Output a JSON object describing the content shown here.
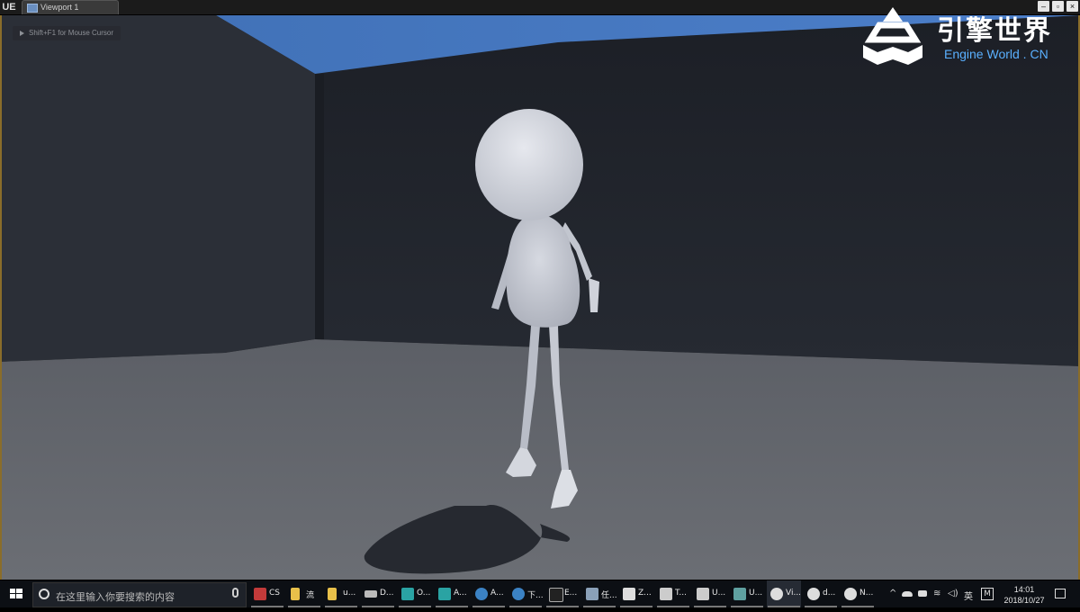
{
  "window": {
    "tab_label": "Viewport 1",
    "logo": "UE",
    "buttons": {
      "minimize": "–",
      "restore": "▫",
      "close": "×"
    }
  },
  "viewport": {
    "hint_text": "Shift+F1 for Mouse Cursor"
  },
  "watermark": {
    "title_cn": "引擎世界",
    "subtitle": "Engine World . CN",
    "accent_color": "#5ab0ff"
  },
  "taskbar": {
    "search_placeholder": "在这里输入你要搜索的内容",
    "apps": [
      {
        "label": "CS",
        "icon": "photoshop-icon",
        "color": "#c23a3a"
      },
      {
        "label": "流",
        "icon": "folder-icon",
        "color": "#e8c04a"
      },
      {
        "label": "u...",
        "icon": "folder-icon",
        "color": "#e8c04a"
      },
      {
        "label": "D...",
        "icon": "drive-icon",
        "color": "#bbbbbb"
      },
      {
        "label": "O...",
        "icon": "maya-icon",
        "color": "#2aa3a3"
      },
      {
        "label": "A...",
        "icon": "maya-icon",
        "color": "#2aa3a3"
      },
      {
        "label": "A...",
        "icon": "app-icon",
        "color": "#3b82c4"
      },
      {
        "label": "下...",
        "icon": "download-icon",
        "color": "#3b82c4"
      },
      {
        "label": "E...",
        "icon": "epic-icon",
        "color": "#222222"
      },
      {
        "label": "任...",
        "icon": "task-icon",
        "color": "#8aa0b8"
      },
      {
        "label": "Z...",
        "icon": "zbrush-icon",
        "color": "#dddddd"
      },
      {
        "label": "T...",
        "icon": "tool-icon",
        "color": "#cccccc"
      },
      {
        "label": "U...",
        "icon": "uv-icon",
        "color": "#cccccc"
      },
      {
        "label": "U...",
        "icon": "image-icon",
        "color": "#5fa0a0"
      },
      {
        "label": "Vi...",
        "icon": "unreal-icon",
        "color": "#dddddd"
      },
      {
        "label": "d...",
        "icon": "unreal-icon",
        "color": "#dddddd"
      },
      {
        "label": "N...",
        "icon": "unreal-icon",
        "color": "#dddddd"
      }
    ],
    "tray": {
      "lang": "英",
      "ime": "M",
      "time": "14:01",
      "date": "2018/10/27"
    }
  }
}
